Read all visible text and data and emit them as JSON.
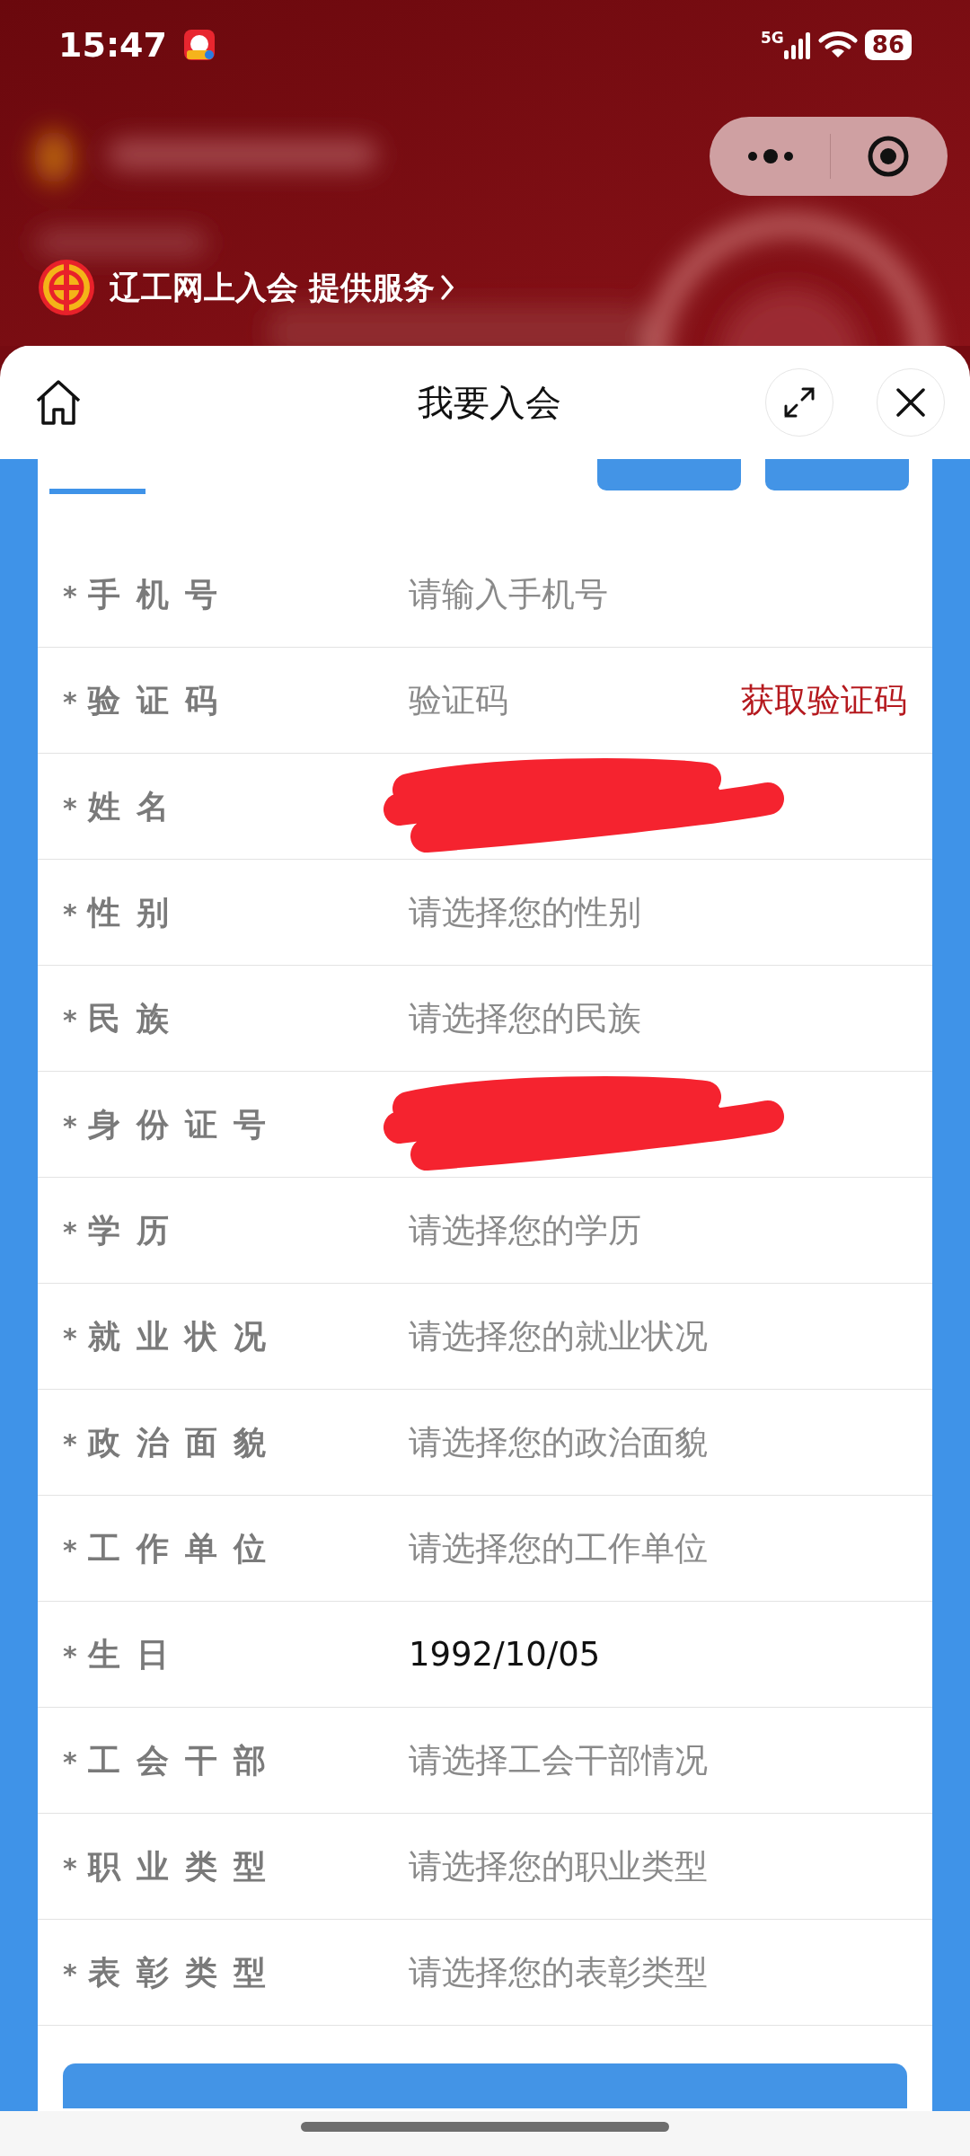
{
  "status_bar": {
    "time": "15:47",
    "network": "5G",
    "battery": "86"
  },
  "mini_program": {
    "provider": "辽工网上入会 提供服务"
  },
  "sheet": {
    "title": "我要入会"
  },
  "fields": [
    {
      "marker": "*",
      "label": "手机号",
      "kind": "input",
      "placeholder": "请输入手机号"
    },
    {
      "marker": "*",
      "label": "验证码",
      "kind": "code",
      "placeholder": "验证码",
      "action": "获取验证码"
    },
    {
      "marker": "*",
      "label": "姓名",
      "kind": "redacted"
    },
    {
      "marker": "*",
      "label": "性别",
      "kind": "select",
      "placeholder": "请选择您的性别"
    },
    {
      "marker": "*",
      "label": "民族",
      "kind": "select",
      "placeholder": "请选择您的民族"
    },
    {
      "marker": "*",
      "label": "身份证号",
      "kind": "redacted"
    },
    {
      "marker": "*",
      "label": "学历",
      "kind": "select",
      "placeholder": "请选择您的学历"
    },
    {
      "marker": "*",
      "label": "就业状况",
      "kind": "select",
      "placeholder": "请选择您的就业状况"
    },
    {
      "marker": "*",
      "label": "政治面貌",
      "kind": "select",
      "placeholder": "请选择您的政治面貌"
    },
    {
      "marker": "*",
      "label": "工作单位",
      "kind": "select",
      "placeholder": "请选择您的工作单位"
    },
    {
      "marker": "*",
      "label": "生日",
      "kind": "value",
      "value": "1992/10/05"
    },
    {
      "marker": "*",
      "label": "工会干部",
      "kind": "select",
      "placeholder": "请选择工会干部情况"
    },
    {
      "marker": "*",
      "label": "职业类型",
      "kind": "select",
      "placeholder": "请选择您的职业类型"
    },
    {
      "marker": "*",
      "label": "表彰类型",
      "kind": "select",
      "placeholder": "请选择您的表彰类型"
    }
  ]
}
